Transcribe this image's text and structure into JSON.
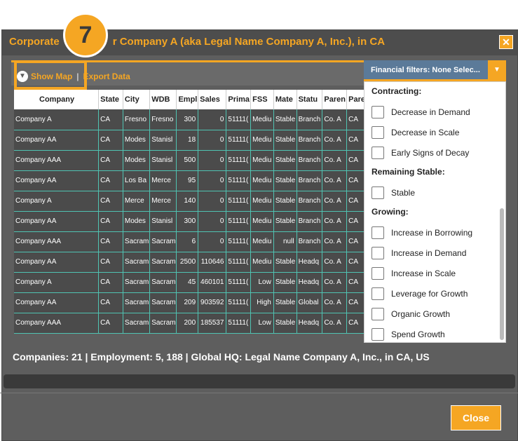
{
  "dialog": {
    "title": "Corporate L... for Company A (aka Legal Name Company A, Inc.), in CA",
    "title_visible_left": "Corporate",
    "title_visible_right": "r Company A (aka Legal Name Company A, Inc.), in CA",
    "close_icon": "close-icon"
  },
  "callout": {
    "number": "7"
  },
  "toolbar": {
    "show_map": "Show Map",
    "separator": "|",
    "export": "Export Data"
  },
  "financial_filter": {
    "label": "Financial filters: None Selec...",
    "arrow_icon": "triangle-down-icon"
  },
  "table": {
    "headers": [
      "Company",
      "State",
      "City",
      "WDB",
      "Empl",
      "Sales",
      "Prima",
      "FSS",
      "Mate",
      "Statu",
      "Paren",
      "Paren"
    ],
    "rows": [
      [
        "Company A",
        "CA",
        "Fresno",
        "Fresno",
        "300",
        "0",
        "51111(",
        "Mediu",
        "Stable",
        "Branch",
        "Co. A",
        "CA"
      ],
      [
        "Company AA",
        "CA",
        "Modes",
        "Stanisl",
        "18",
        "0",
        "51111(",
        "Mediu",
        "Stable",
        "Branch",
        "Co. A",
        "CA"
      ],
      [
        "Company AAA",
        "CA",
        "Modes",
        "Stanisl",
        "500",
        "0",
        "51111(",
        "Mediu",
        "Stable",
        "Branch",
        "Co. A",
        "CA"
      ],
      [
        "Company AA",
        "CA",
        "Los Ba",
        "Merce",
        "95",
        "0",
        "51111(",
        "Mediu",
        "Stable",
        "Branch",
        "Co. A",
        "CA"
      ],
      [
        "Company A",
        "CA",
        "Merce",
        "Merce",
        "140",
        "0",
        "51111(",
        "Mediu",
        "Stable",
        "Branch",
        "Co. A",
        "CA"
      ],
      [
        "Company AA",
        "CA",
        "Modes",
        "Stanisl",
        "300",
        "0",
        "51111(",
        "Mediu",
        "Stable",
        "Branch",
        "Co. A",
        "CA"
      ],
      [
        "Company AAA",
        "CA",
        "Sacram",
        "Sacram",
        "6",
        "0",
        "51111(",
        "Mediu",
        "null",
        "Branch",
        "Co. A",
        "CA"
      ],
      [
        "Company AA",
        "CA",
        "Sacram",
        "Sacram",
        "2500",
        "110646",
        "51111(",
        "Mediu",
        "Stable",
        "Headq",
        "Co. A",
        "CA"
      ],
      [
        "Company A",
        "CA",
        "Sacram",
        "Sacram",
        "45",
        "460101",
        "51111(",
        "Low",
        "Stable",
        "Headq",
        "Co. A",
        "CA"
      ],
      [
        "Company AA",
        "CA",
        "Sacram",
        "Sacram",
        "209",
        "903592",
        "51111(",
        "High",
        "Stable",
        "Global",
        "Co. A",
        "CA"
      ],
      [
        "Company AAA",
        "CA",
        "Sacram",
        "Sacram",
        "200",
        "185537",
        "51111(",
        "Low",
        "Stable",
        "Headq",
        "Co. A",
        "CA"
      ]
    ]
  },
  "filter_dropdown": {
    "groups": [
      {
        "heading": "Contracting:",
        "items": [
          "Decrease in Demand",
          "Decrease in Scale",
          "Early Signs of Decay"
        ]
      },
      {
        "heading": "Remaining Stable:",
        "items": [
          "Stable"
        ]
      },
      {
        "heading": "Growing:",
        "items": [
          "Increase in Borrowing",
          "Increase in Demand",
          "Increase in Scale",
          "Leverage for Growth",
          "Organic Growth",
          "Spend Growth"
        ]
      }
    ]
  },
  "summary": "Companies: 21 | Employment: 5, 188 | Global HQ: Legal Name Company A, Inc., in CA, US",
  "footer": {
    "close": "Close"
  },
  "colors": {
    "accent": "#f5a623",
    "panel": "#5e5e5e",
    "grid_line": "#4fc3b2",
    "filter_button": "#5b7a99"
  }
}
